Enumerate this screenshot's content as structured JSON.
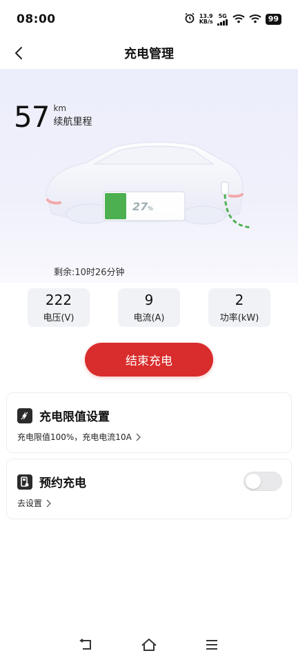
{
  "status": {
    "time": "08:00",
    "net_speed_value": "13.9",
    "net_speed_unit": "KB/s",
    "network_type": "5G",
    "battery": "99"
  },
  "header": {
    "title": "充电管理"
  },
  "hero": {
    "range_value": "57",
    "range_unit": "km",
    "range_label": "续航里程",
    "soc_value": "27",
    "soc_unit": "%",
    "soc_fraction": 0.27,
    "remaining": "剩余:10时26分钟"
  },
  "stats": [
    {
      "value": "222",
      "label": "电压(V)"
    },
    {
      "value": "9",
      "label": "电流(A)"
    },
    {
      "value": "2",
      "label": "功率(kW)"
    }
  ],
  "actions": {
    "end_charge_label": "结束充电"
  },
  "cards": {
    "limit": {
      "title": "充电限值设置",
      "subtitle": "充电限值100%，充电电流10A"
    },
    "schedule": {
      "title": "预约充电",
      "subtitle": "去设置",
      "toggle_on": false
    }
  },
  "colors": {
    "accent": "#d92c2c",
    "battery_fill": "#4cb050"
  },
  "icons": {
    "back": "back-arrow-icon",
    "limit": "lightning-icon",
    "schedule": "charger-station-icon",
    "nav_back": "nav-back-icon",
    "nav_home": "nav-home-icon",
    "nav_menu": "nav-menu-icon"
  }
}
